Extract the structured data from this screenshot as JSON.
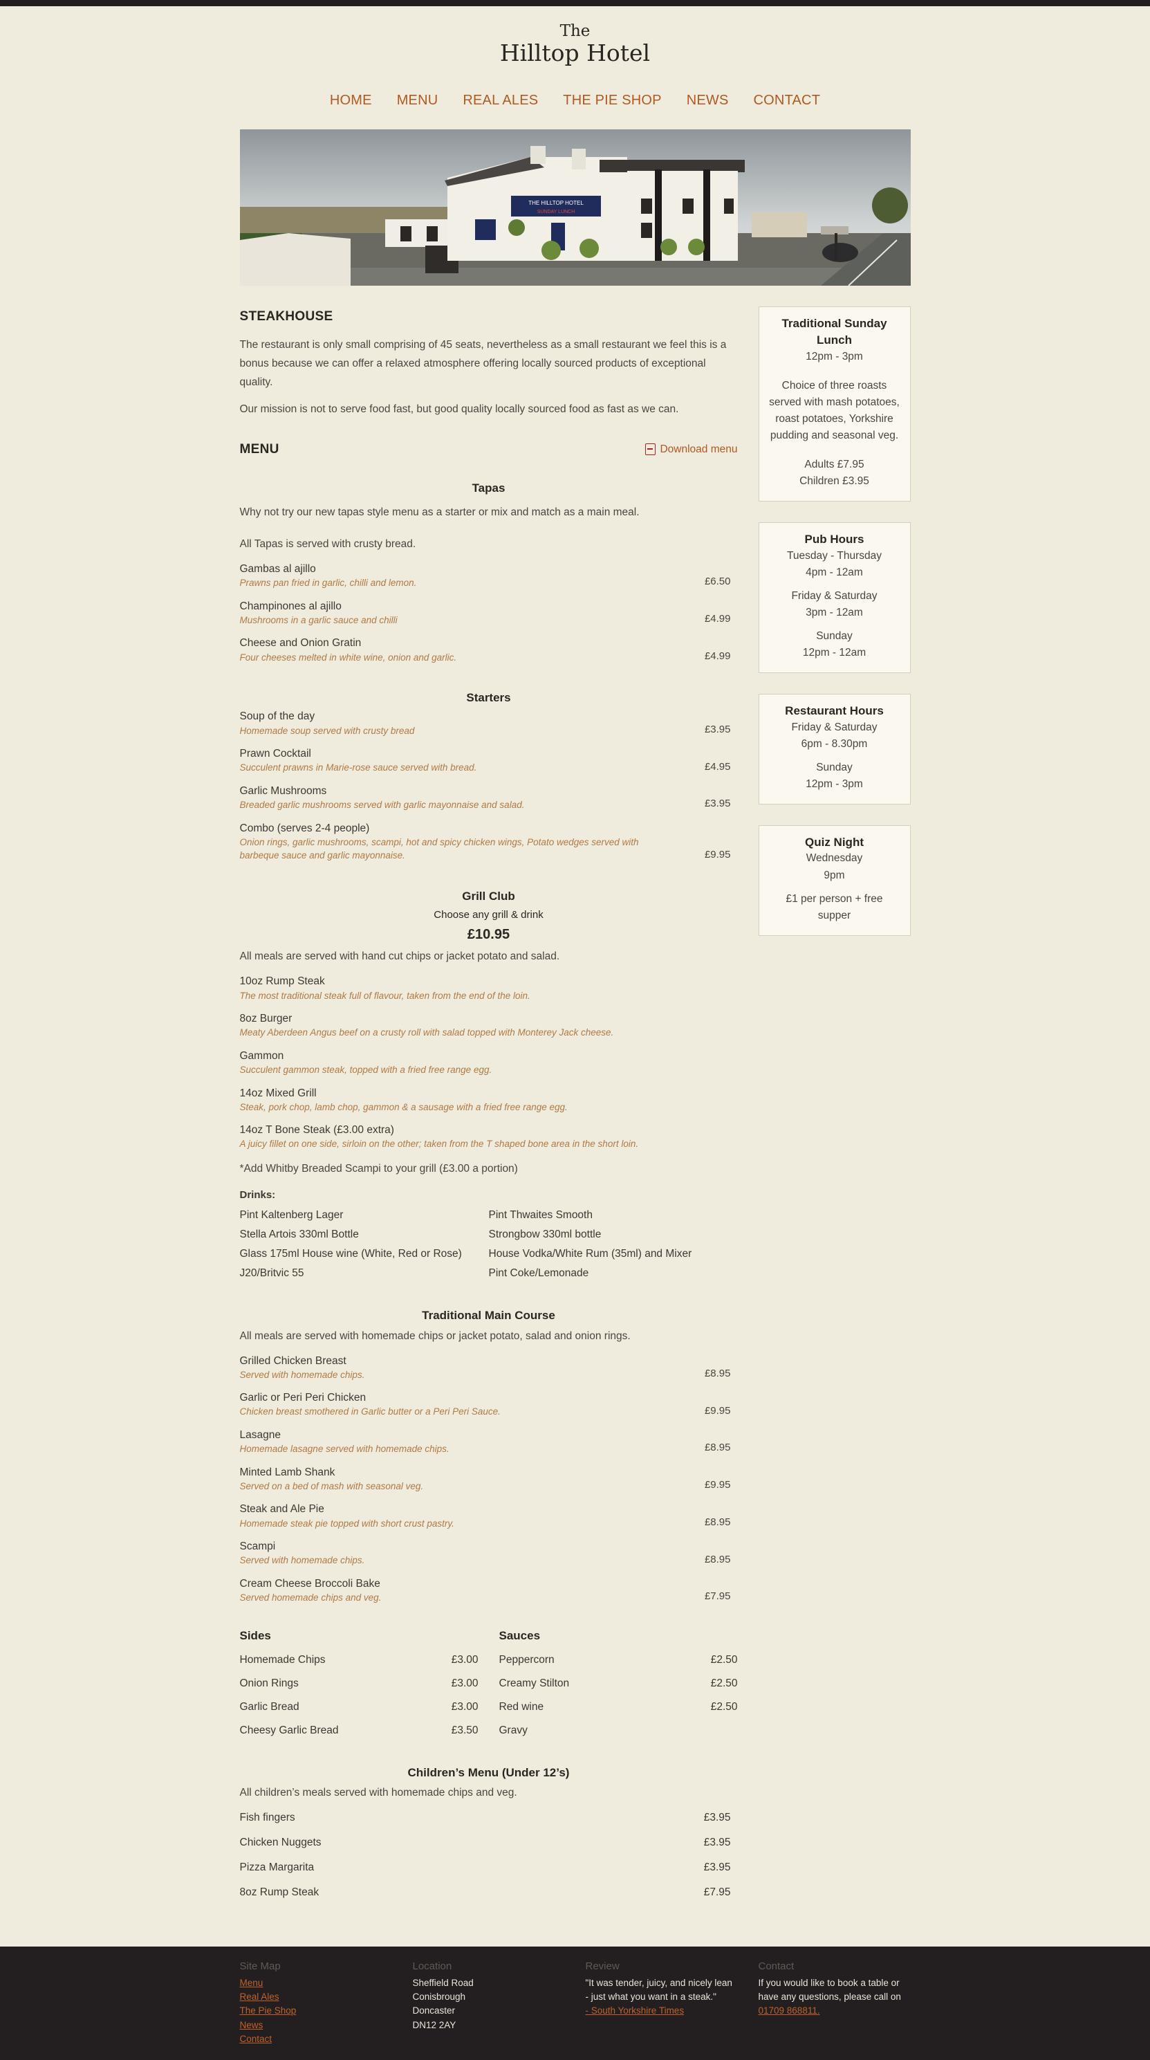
{
  "header": {
    "logo_line1": "The",
    "logo_line2": "Hilltop Hotel"
  },
  "nav": [
    "HOME",
    "MENU",
    "REAL ALES",
    "THE PIE SHOP",
    "NEWS",
    "CONTACT"
  ],
  "hero": {
    "sign_title": "THE HILLTOP HOTEL",
    "sign_sub": "SUNDAY LUNCH"
  },
  "intro": {
    "title": "STEAKHOUSE",
    "p1": "The restaurant is only small comprising of 45 seats, nevertheless as a small restaurant we feel this is a bonus because we can offer a relaxed atmosphere offering locally sourced products of exceptional quality.",
    "p2": "Our mission is not to serve food fast, but good quality locally sourced food as fast as we can."
  },
  "menu": {
    "title": "MENU",
    "download": "Download menu",
    "tapas": {
      "title": "Tapas",
      "note1": "Why not try our new tapas style menu as a starter or mix and match as a main meal.",
      "note2": "All Tapas is served with crusty bread.",
      "items": [
        {
          "name": "Gambas al ajillo",
          "desc": "Prawns pan fried in garlic, chilli and lemon.",
          "price": "£6.50"
        },
        {
          "name": "Champinones al ajillo",
          "desc": "Mushrooms in a garlic sauce and chilli",
          "price": "£4.99"
        },
        {
          "name": "Cheese and Onion Gratin",
          "desc": "Four cheeses melted in white wine, onion and garlic.",
          "price": "£4.99"
        }
      ]
    },
    "starters": {
      "title": "Starters",
      "items": [
        {
          "name": "Soup of the day",
          "desc": "Homemade soup served with crusty bread",
          "price": "£3.95"
        },
        {
          "name": "Prawn Cocktail",
          "desc": "Succulent prawns in Marie-rose sauce served with bread.",
          "price": "£4.95"
        },
        {
          "name": "Garlic Mushrooms",
          "desc": "Breaded garlic mushrooms served with garlic mayonnaise and salad.",
          "price": "£3.95"
        },
        {
          "name": "Combo (serves 2-4 people)",
          "desc": "Onion rings, garlic mushrooms, scampi, hot and spicy chicken wings, Potato wedges served with barbeque sauce and garlic mayonnaise.",
          "price": "£9.95"
        }
      ]
    },
    "grill": {
      "title": "Grill Club",
      "sub": "Choose any grill & drink",
      "price": "£10.95",
      "note": "All meals are served with hand cut chips or jacket potato and salad.",
      "items": [
        {
          "name": "10oz Rump Steak",
          "desc": "The most traditional steak full of flavour, taken from the end of the loin."
        },
        {
          "name": "8oz Burger",
          "desc": "Meaty Aberdeen Angus beef on a crusty roll with salad topped with Monterey Jack cheese."
        },
        {
          "name": "Gammon",
          "desc": "Succulent gammon steak, topped with a fried free range egg."
        },
        {
          "name": "14oz Mixed Grill",
          "desc": "Steak, pork chop, lamb chop, gammon & a sausage with a fried free range egg."
        },
        {
          "name": "14oz T Bone Steak (£3.00 extra)",
          "desc": "A juicy fillet on one side, sirloin on the other; taken from the T shaped bone area in the short loin."
        }
      ],
      "scampi_note": "*Add Whitby Breaded Scampi to your grill (£3.00 a portion)",
      "drinks_title": "Drinks:",
      "drinks": [
        "Pint Kaltenberg Lager",
        "Pint Thwaites Smooth",
        "Stella Artois 330ml Bottle",
        "Strongbow 330ml bottle",
        "Glass 175ml House wine (White, Red or Rose)",
        "House Vodka/White Rum (35ml) and Mixer",
        "J20/Britvic 55",
        "Pint Coke/Lemonade"
      ]
    },
    "main_course": {
      "title": "Traditional Main Course",
      "note": "All meals are served with homemade chips or jacket potato, salad and onion rings.",
      "items": [
        {
          "name": "Grilled Chicken Breast",
          "desc": "Served with homemade chips.",
          "price": "£8.95"
        },
        {
          "name": "Garlic or Peri Peri Chicken",
          "desc": "Chicken breast smothered in Garlic butter or a Peri Peri Sauce.",
          "price": "£9.95"
        },
        {
          "name": "Lasagne",
          "desc": "Homemade lasagne served with homemade chips.",
          "price": "£8.95"
        },
        {
          "name": "Minted Lamb Shank",
          "desc": "Served on a bed of mash with seasonal veg.",
          "price": "£9.95"
        },
        {
          "name": "Steak and Ale Pie",
          "desc": "Homemade steak pie topped with short crust pastry.",
          "price": "£8.95"
        },
        {
          "name": "Scampi",
          "desc": "Served with homemade chips.",
          "price": "£8.95"
        },
        {
          "name": "Cream Cheese Broccoli Bake",
          "desc": "Served homemade chips and veg.",
          "price": "£7.95"
        }
      ]
    },
    "sides": {
      "title": "Sides",
      "items": [
        {
          "name": "Homemade Chips",
          "price": "£3.00"
        },
        {
          "name": "Onion Rings",
          "price": "£3.00"
        },
        {
          "name": "Garlic Bread",
          "price": "£3.00"
        },
        {
          "name": "Cheesy Garlic Bread",
          "price": "£3.50"
        }
      ]
    },
    "sauces": {
      "title": "Sauces",
      "items": [
        {
          "name": "Peppercorn",
          "price": "£2.50"
        },
        {
          "name": "Creamy Stilton",
          "price": "£2.50"
        },
        {
          "name": "Red wine",
          "price": "£2.50"
        },
        {
          "name": "Gravy",
          "price": ""
        }
      ]
    },
    "children": {
      "title": "Children’s Menu (Under 12’s)",
      "note": "All children’s meals served with homemade chips and veg.",
      "items": [
        {
          "name": "Fish fingers",
          "price": "£3.95"
        },
        {
          "name": "Chicken Nuggets",
          "price": "£3.95"
        },
        {
          "name": "Pizza Margarita",
          "price": "£3.95"
        },
        {
          "name": "8oz Rump Steak",
          "price": "£7.95"
        }
      ]
    }
  },
  "sidebar": {
    "sunday": {
      "title": "Traditional Sunday Lunch",
      "time": "12pm - 3pm",
      "desc": "Choice of three roasts served with mash potatoes, roast potatoes, Yorkshire pudding and seasonal veg.",
      "adults": "Adults £7.95",
      "children": "Children £3.95"
    },
    "pub": {
      "title": "Pub Hours",
      "l1": "Tuesday - Thursday",
      "l2": "4pm - 12am",
      "l3": "Friday & Saturday",
      "l4": "3pm - 12am",
      "l5": "Sunday",
      "l6": "12pm - 12am"
    },
    "restaurant": {
      "title": "Restaurant Hours",
      "l1": "Friday & Saturday",
      "l2": "6pm - 8.30pm",
      "l3": "Sunday",
      "l4": "12pm - 3pm"
    },
    "quiz": {
      "title": "Quiz Night",
      "l1": "Wednesday",
      "l2": "9pm",
      "l3": "£1 per person + free supper"
    }
  },
  "footer": {
    "sitemap": {
      "title": "Site Map",
      "links": [
        "Menu",
        "Real Ales",
        "The Pie Shop",
        "News",
        "Contact"
      ]
    },
    "location": {
      "title": "Location",
      "lines": [
        "Sheffield Road",
        "Conisbrough",
        "Doncaster",
        "DN12 2AY"
      ]
    },
    "review": {
      "title": "Review",
      "quote": "\"It was tender, juicy, and nicely lean - just what you want in a steak.\"",
      "source": "- South Yorkshire Times"
    },
    "contact": {
      "title": "Contact",
      "text": "If you would like to book a table or have any questions, please call on",
      "phone": "01709 868811."
    }
  },
  "colors": {
    "background": "#efebdd",
    "accent": "#b05a22",
    "footer": "#231f20",
    "desc": "#b07a45"
  }
}
